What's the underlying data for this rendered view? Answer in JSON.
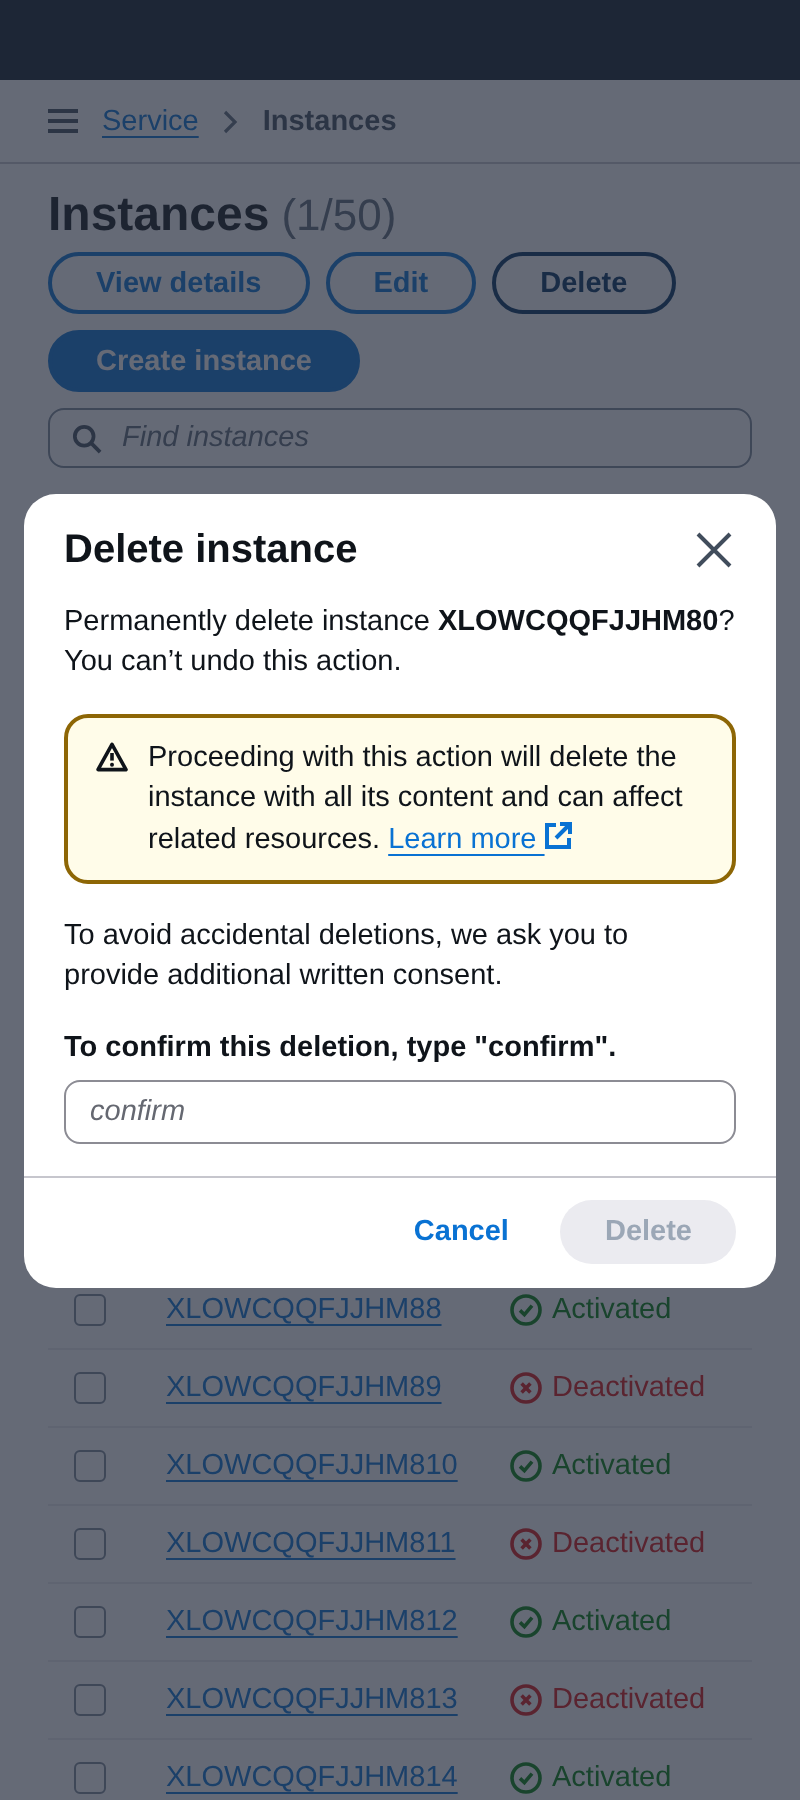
{
  "breadcrumb": [
    {
      "label": "Service",
      "kind": "link"
    },
    {
      "label": "Instances",
      "kind": "current"
    }
  ],
  "heading": {
    "title": "Instances",
    "count": "(1/50)"
  },
  "actions": [
    {
      "label": "View details",
      "kind": "normal",
      "focused": false
    },
    {
      "label": "Edit",
      "kind": "normal",
      "focused": false
    },
    {
      "label": "Delete",
      "kind": "normal",
      "focused": true
    },
    {
      "label": "Create instance",
      "kind": "primary",
      "focused": false
    }
  ],
  "search": {
    "placeholder": "Find instances"
  },
  "rows": [
    {
      "name": "XLOWCQQFJJHM88",
      "status": "Activated",
      "kind": "activated",
      "checked": false
    },
    {
      "name": "XLOWCQQFJJHM89",
      "status": "Deactivated",
      "kind": "deactivated",
      "checked": false
    },
    {
      "name": "XLOWCQQFJJHM810",
      "status": "Activated",
      "kind": "activated",
      "checked": false
    },
    {
      "name": "XLOWCQQFJJHM811",
      "status": "Deactivated",
      "kind": "deactivated",
      "checked": false
    },
    {
      "name": "XLOWCQQFJJHM812",
      "status": "Activated",
      "kind": "activated",
      "checked": false
    },
    {
      "name": "XLOWCQQFJJHM813",
      "status": "Deactivated",
      "kind": "deactivated",
      "checked": false
    },
    {
      "name": "XLOWCQQFJJHM814",
      "status": "Activated",
      "kind": "activated",
      "checked": false
    }
  ],
  "modal": {
    "title": "Delete instance",
    "message": "Permanently delete instance **XLOWCQQFJJHM80**? You can’t undo this action.",
    "warning": {
      "text": "Proceeding with this action will delete the instance with all its content and can affect related resources.",
      "link": "Learn more"
    },
    "consent": "To avoid accidental deletions, we ask you to provide additional written consent.",
    "field": {
      "label": "To confirm this deletion, type \"confirm\".",
      "placeholder": "confirm"
    },
    "buttons": [
      {
        "label": "Cancel",
        "kind": "link",
        "disabled": false
      },
      {
        "label": "Delete",
        "kind": "primary",
        "disabled": true
      }
    ]
  }
}
